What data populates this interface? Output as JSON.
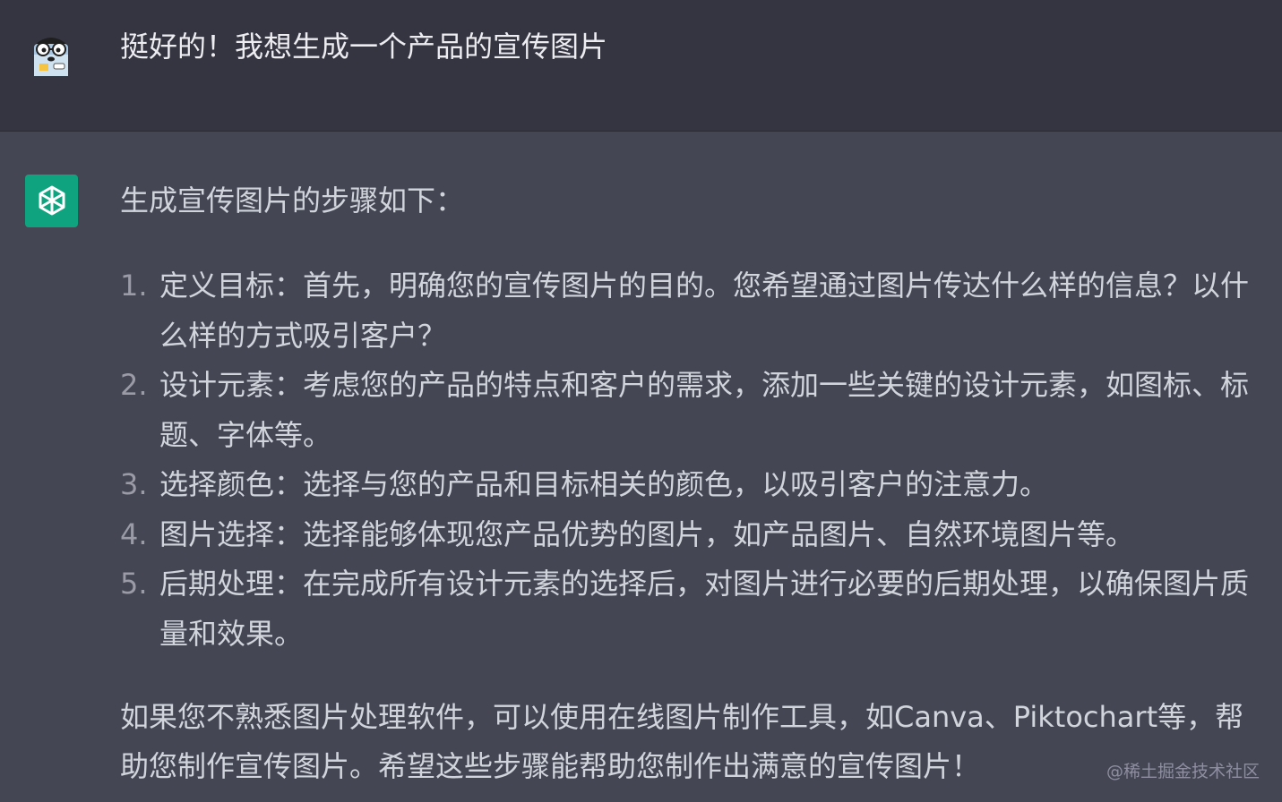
{
  "user_message": {
    "text": "挺好的！我想生成一个产品的宣传图片",
    "avatar_icon": "user-avatar-icon"
  },
  "assistant_message": {
    "avatar_icon": "openai-logo-icon",
    "avatar_color": "#10a37f",
    "intro": "生成宣传图片的步骤如下：",
    "steps": [
      {
        "num": "1.",
        "text": "定义目标：首先，明确您的宣传图片的目的。您希望通过图片传达什么样的信息？以什么样的方式吸引客户？"
      },
      {
        "num": "2.",
        "text": "设计元素：考虑您的产品的特点和客户的需求，添加一些关键的设计元素，如图标、标题、字体等。"
      },
      {
        "num": "3.",
        "text": "选择颜色：选择与您的产品和目标相关的颜色，以吸引客户的注意力。"
      },
      {
        "num": "4.",
        "text": "图片选择：选择能够体现您产品优势的图片，如产品图片、自然环境图片等。"
      },
      {
        "num": "5.",
        "text": "后期处理：在完成所有设计元素的选择后，对图片进行必要的后期处理，以确保图片质量和效果。"
      }
    ],
    "outro": "如果您不熟悉图片处理软件，可以使用在线图片制作工具，如Canva、Piktochart等，帮助您制作宣传图片。希望这些步骤能帮助您制作出满意的宣传图片！"
  },
  "watermark": "@稀土掘金技术社区",
  "colors": {
    "user_bg": "#343541",
    "assistant_bg": "#444654",
    "text": "#d1d5db"
  }
}
